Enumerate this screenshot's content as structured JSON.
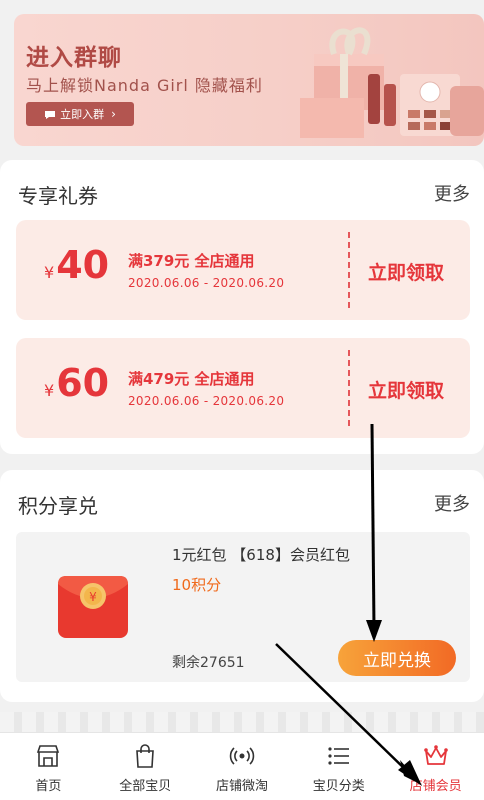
{
  "banner": {
    "title": "进入群聊",
    "subtitle": "马上解锁Nanda Girl 隐藏福利",
    "join_label": "立即入群",
    "chevron": "›"
  },
  "coupons": {
    "title": "专享礼券",
    "more": "更多",
    "items": [
      {
        "currency": "¥",
        "amount": "40",
        "condition": "满379元 全店通用",
        "dates": "2020.06.06 - 2020.06.20",
        "claim_label": "立即领取"
      },
      {
        "currency": "¥",
        "amount": "60",
        "condition": "满479元 全店通用",
        "dates": "2020.06.06 - 2020.06.20",
        "claim_label": "立即领取"
      }
    ]
  },
  "points": {
    "title": "积分享兑",
    "more": "更多",
    "product": {
      "name": "1元红包 【618】会员红包",
      "points": "10积分",
      "remaining": "剩余27651",
      "redeem_label": "立即兑换",
      "icon": "red-envelope-icon"
    }
  },
  "tabbar": {
    "items": [
      {
        "label": "首页",
        "icon": "store-icon"
      },
      {
        "label": "全部宝贝",
        "icon": "shopping-bag-icon"
      },
      {
        "label": "店铺微淘",
        "icon": "broadcast-icon"
      },
      {
        "label": "宝贝分类",
        "icon": "list-icon"
      },
      {
        "label": "店铺会员",
        "icon": "crown-icon"
      }
    ],
    "active_index": 4
  },
  "colors": {
    "accent_red": "#e5363b",
    "orange": "#f06a1c",
    "banner_bg": "#f6cfc8",
    "coupon_bg": "#fcebe6"
  }
}
